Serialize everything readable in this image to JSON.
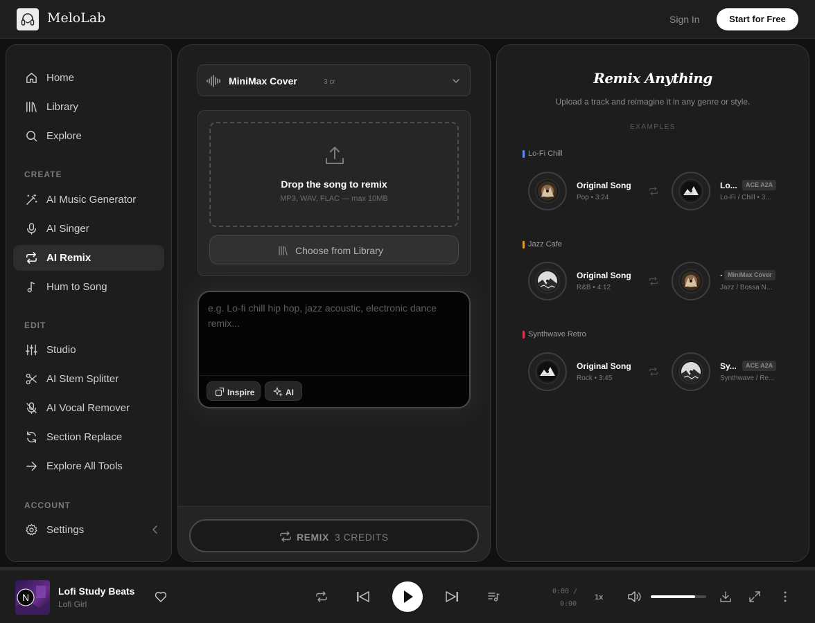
{
  "app": {
    "name": "MeloLab"
  },
  "header": {
    "sign_in": "Sign In",
    "start_free": "Start for Free"
  },
  "sidebar": {
    "top": [
      {
        "label": "Home",
        "icon": "home-icon"
      },
      {
        "label": "Library",
        "icon": "library-icon"
      },
      {
        "label": "Explore",
        "icon": "search-icon"
      }
    ],
    "create_title": "CREATE",
    "create": [
      {
        "label": "AI Music Generator",
        "icon": "magic-wand-icon"
      },
      {
        "label": "AI Singer",
        "icon": "microphone-icon"
      },
      {
        "label": "AI Remix",
        "icon": "repeat-icon",
        "active": true
      },
      {
        "label": "Hum to Song",
        "icon": "music-note-icon"
      }
    ],
    "edit_title": "EDIT",
    "edit": [
      {
        "label": "Studio",
        "icon": "sliders-icon"
      },
      {
        "label": "AI Stem Splitter",
        "icon": "scissors-icon"
      },
      {
        "label": "AI Vocal Remover",
        "icon": "mic-off-icon"
      },
      {
        "label": "Section Replace",
        "icon": "refresh-icon"
      },
      {
        "label": "Explore All Tools",
        "icon": "arrow-right-icon"
      }
    ],
    "account_title": "ACCOUNT",
    "account": [
      {
        "label": "Settings",
        "icon": "gear-icon"
      }
    ]
  },
  "remix": {
    "model_name": "MiniMax Cover",
    "model_cost": "3 cr",
    "drop_title": "Drop the song to remix",
    "drop_sub": "MP3, WAV, FLAC — max 10MB",
    "library_button": "Choose from Library",
    "prompt_placeholder": "e.g. Lo-fi chill hip hop, jazz acoustic, electronic dance remix...",
    "inspire_label": "Inspire",
    "ai_label": "AI",
    "remix_label": "REMIX",
    "credits_label": "3 CREDITS"
  },
  "examples": {
    "title": "Remix Anything",
    "subtitle": "Upload a track and reimagine it in any genre or style.",
    "label": "EXAMPLES",
    "groups": [
      {
        "name": "Lo-Fi Chill",
        "color": "#5b8ef0",
        "original": {
          "title": "Original Song",
          "meta": "Pop • 3:24"
        },
        "remix": {
          "title": "Lo...",
          "tag": "ACE A2A",
          "meta": "Lo-Fi / Chill • 3..."
        }
      },
      {
        "name": "Jazz Cafe",
        "color": "#e0982c",
        "original": {
          "title": "Original Song",
          "meta": "R&B • 4:12"
        },
        "remix": {
          "title": "·",
          "tag": "MiniMax Cover",
          "meta": "Jazz / Bossa N..."
        }
      },
      {
        "name": "Synthwave Retro",
        "color": "#e0384a",
        "original": {
          "title": "Original Song",
          "meta": "Rock • 3:45"
        },
        "remix": {
          "title": "Sy...",
          "tag": "ACE A2A",
          "meta": "Synthwave / Re..."
        }
      }
    ]
  },
  "player": {
    "title": "Lofi Study Beats",
    "artist": "Lofi Girl",
    "cover_letter": "N",
    "time_current": "0:00 /",
    "time_total": "0:00",
    "speed": "1x",
    "volume": 0.8
  }
}
